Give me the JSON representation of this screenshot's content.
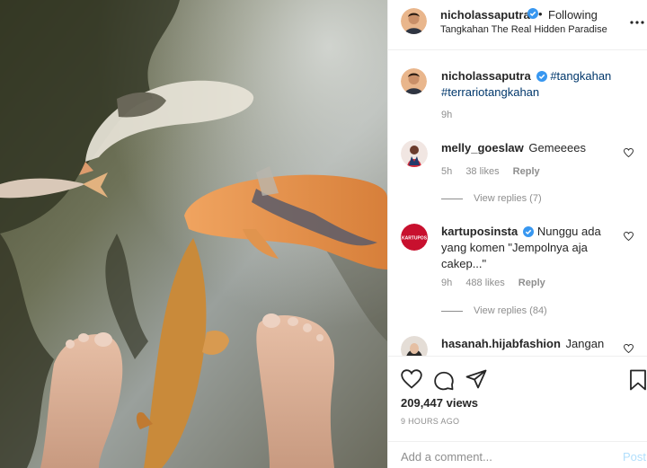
{
  "post": {
    "author": "nicholassaputra",
    "follow_status": "Following",
    "separator": "•",
    "location": "Tangkahan The Real Hidden Paradise",
    "more_icon": "more-horizontal-icon",
    "caption": {
      "author": "nicholassaputra",
      "hashtags": [
        "#tangkahan",
        "#terrariotangkahan"
      ],
      "time": "9h"
    }
  },
  "comments": [
    {
      "username": "melly_goeslaw",
      "verified": false,
      "text": "Gemeeees",
      "time": "5h",
      "likes": "38 likes",
      "reply_label": "Reply",
      "view_replies": "View replies (7)"
    },
    {
      "username": "kartuposinsta",
      "verified": true,
      "text": "Nunggu ada yang komen \"Jempolnya aja cakep...\"",
      "time": "9h",
      "likes": "488 likes",
      "reply_label": "Reply",
      "view_replies": "View replies (84)"
    },
    {
      "username": "hasanah.hijabfashion",
      "verified": false,
      "text": "Jangan"
    }
  ],
  "actions": {
    "icons": [
      "heart-icon",
      "comment-icon",
      "share-icon",
      "bookmark-icon"
    ],
    "views": "209,447 views",
    "timestamp": "9 HOURS AGO"
  },
  "add_comment": {
    "placeholder": "Add a comment...",
    "post_label": "Post"
  },
  "colors": {
    "text": "#262626",
    "secondary": "#8e8e8e",
    "hashtag": "#00376b",
    "verified": "#3897f0",
    "post_disabled": "#b2dffc",
    "border": "#efefef"
  }
}
